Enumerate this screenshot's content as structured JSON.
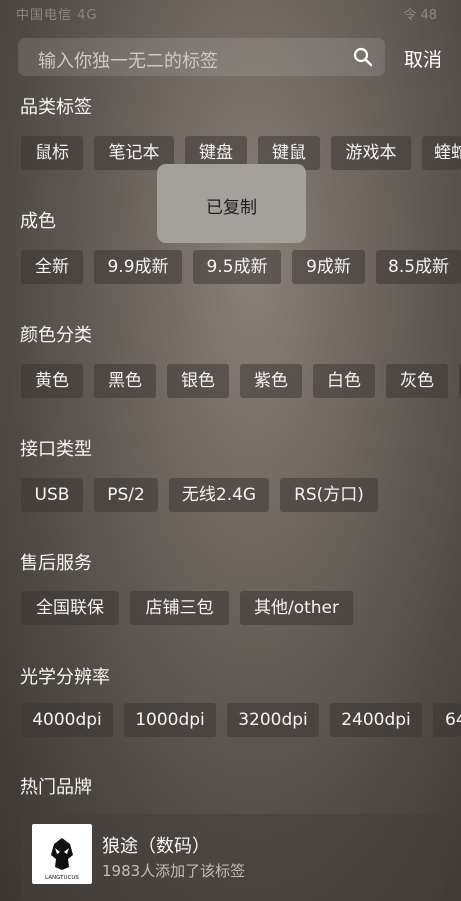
{
  "status_bar": {
    "left": "中国电信 4G",
    "right": "令 48"
  },
  "search": {
    "placeholder": "输入你独一无二的标签",
    "cancel_label": "取消"
  },
  "toast": {
    "text": "已复制"
  },
  "sections": [
    {
      "title": "品类标签",
      "chips": [
        "鼠标",
        "笔记本",
        "键盘",
        "键鼠",
        "游戏本",
        "蝰蛇"
      ]
    },
    {
      "title": "成色",
      "chips": [
        "全新",
        "9.9成新",
        "9.5成新",
        "9成新",
        "8.5成新"
      ]
    },
    {
      "title": "颜色分类",
      "chips": [
        "黄色",
        "黑色",
        "银色",
        "紫色",
        "白色",
        "灰色"
      ]
    },
    {
      "title": "接口类型",
      "chips": [
        "USB",
        "PS/2",
        "无线2.4G",
        "RS(方口)"
      ]
    },
    {
      "title": "售后服务",
      "chips": [
        "全国联保",
        "店铺三包",
        "其他/other"
      ]
    },
    {
      "title": "光学分辨率",
      "chips": [
        "4000dpi",
        "1000dpi",
        "3200dpi",
        "2400dpi",
        "64"
      ]
    },
    {
      "title": "热门品牌"
    }
  ],
  "brand_card": {
    "name": "狼途（数码）",
    "subtitle": "1983人添加了该标签",
    "logo_text": "LANGTUCUS"
  },
  "colors": {
    "toast_bg": "#a4a09c",
    "chip_bg": "#3c3734"
  }
}
